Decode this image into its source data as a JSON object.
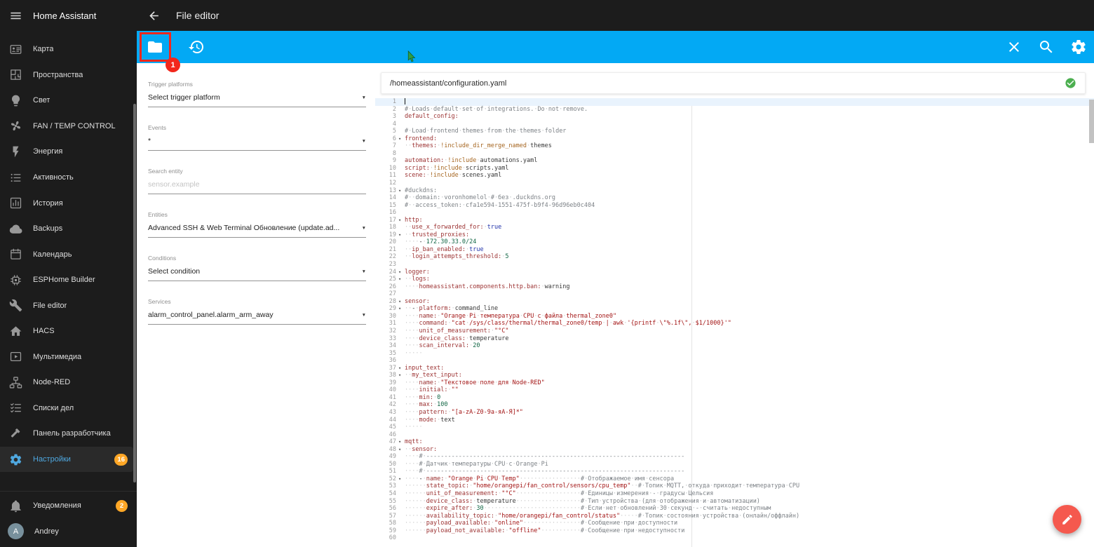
{
  "colors": {
    "sidebar_bg": "#1c1c1c",
    "toolbar_blue": "#03a9f4",
    "active_blue": "#4fa8e0",
    "badge_amber": "#ffa726",
    "annotation_red": "#f2271c",
    "fab_red": "#f5594e",
    "success_green": "#4caf50",
    "avatar_bg": "#78909c"
  },
  "sidebar": {
    "title": "Home Assistant",
    "items": [
      {
        "id": "map",
        "label": "Карта",
        "icon": "card-account-icon"
      },
      {
        "id": "spaces",
        "label": "Пространства",
        "icon": "floor-plan-icon"
      },
      {
        "id": "light",
        "label": "Свет",
        "icon": "lightbulb-icon"
      },
      {
        "id": "fan-temp-control",
        "label": "FAN / TEMP CONTROL",
        "icon": "fan-icon"
      },
      {
        "id": "energy",
        "label": "Энергия",
        "icon": "flash-icon"
      },
      {
        "id": "activity",
        "label": "Активность",
        "icon": "list-icon"
      },
      {
        "id": "history",
        "label": "История",
        "icon": "chart-icon"
      },
      {
        "id": "backups",
        "label": "Backups",
        "icon": "cloud-icon"
      },
      {
        "id": "calendar",
        "label": "Календарь",
        "icon": "calendar-icon"
      },
      {
        "id": "esphome-builder",
        "label": "ESPHome Builder",
        "icon": "chip-icon"
      },
      {
        "id": "file-editor",
        "label": "File editor",
        "icon": "wrench-icon"
      },
      {
        "id": "hacs",
        "label": "HACS",
        "icon": "home-icon"
      },
      {
        "id": "media",
        "label": "Мультимедиа",
        "icon": "media-icon"
      },
      {
        "id": "node-red",
        "label": "Node-RED",
        "icon": "sitemap-icon"
      },
      {
        "id": "todo-lists",
        "label": "Списки дел",
        "icon": "todo-icon"
      },
      {
        "id": "developer-tools",
        "label": "Панель разработчика",
        "icon": "hammer-icon"
      },
      {
        "id": "settings",
        "label": "Настройки",
        "icon": "gear-icon",
        "badge": "16",
        "active": true
      }
    ],
    "bottom_items": [
      {
        "id": "notifications",
        "label": "Уведомления",
        "icon": "bell-icon",
        "badge": "2"
      },
      {
        "id": "profile",
        "label": "Andrey",
        "avatar_letter": "A"
      }
    ]
  },
  "header": {
    "title": "File editor"
  },
  "toolbar": {
    "annotation_badge": "1"
  },
  "panel": {
    "fields": [
      {
        "id": "trigger-platform",
        "type": "select",
        "label": "Trigger platforms",
        "value": "Select trigger platform"
      },
      {
        "id": "events",
        "type": "select",
        "label": "Events",
        "value": "*"
      },
      {
        "id": "search-entity",
        "type": "input",
        "label": "Search entity",
        "placeholder": "sensor.example"
      },
      {
        "id": "entities",
        "type": "select",
        "label": "Entities",
        "value": "Advanced SSH & Web Terminal Обновление (update.ad..."
      },
      {
        "id": "conditions",
        "type": "select",
        "label": "Conditions",
        "value": "Select condition"
      },
      {
        "id": "services",
        "type": "select",
        "label": "Services",
        "value": "alarm_control_panel.alarm_arm_away"
      }
    ]
  },
  "editor": {
    "filepath": "/homeassistant/configuration.yaml",
    "active_line": 1,
    "fold_lines": [
      6,
      13,
      17,
      19,
      24,
      25,
      28,
      29,
      37,
      38,
      47,
      48,
      52
    ],
    "lines": [
      "",
      "# Loads default set of integrations. Do not remove.",
      "default_config:",
      "",
      "# Load frontend themes from the themes folder",
      "frontend:",
      "  themes: !include_dir_merge_named themes",
      "",
      "automation: !include automations.yaml",
      "script: !include scripts.yaml",
      "scene: !include scenes.yaml",
      "",
      "#duckdns:",
      "#  domain: voronhomelol # без .duckdns.org",
      "#  access_token: cfa1e594-1551-475f-b9f4-96d96eb0c404",
      "",
      "http:",
      "  use_x_forwarded_for: true",
      "  trusted_proxies:",
      "    - 172.30.33.0/24",
      "  ip_ban_enabled: true",
      "  login_attempts_threshold: 5",
      "",
      "logger:",
      "  logs:",
      "    homeassistant.components.http.ban: warning",
      "",
      "sensor:",
      "  - platform: command_line",
      "    name: \"Orange Pi температура CPU с файла thermal_zone0\"",
      "    command: \"cat /sys/class/thermal/thermal_zone0/temp | awk '{printf \\\"%.1f\\\", $1/1000}'\"",
      "    unit_of_measurement: \"°C\"",
      "    device_class: temperature",
      "    scan_interval: 20",
      "     ",
      "",
      "input_text:",
      "  my_text_input:",
      "    name: \"Текстовое поле для Node-RED\"",
      "    initial: \"\"",
      "    min: 0",
      "    max: 100",
      "    pattern: \"[a-zA-Z0-9a-яА-Я]*\"",
      "    mode: text",
      "     ",
      "",
      "mqtt:",
      "  sensor:",
      "    # ------------------------------------------------------------------------",
      "    # Датчик температуры CPU с Orange Pi",
      "    # ------------------------------------------------------------------------",
      "    - name: \"Orange Pi CPU Temp\"                 # Отображаемое имя сенсора",
      "      state_topic: \"home/orangepi/fan_control/sensors/cpu_temp\"  # Топик MQTT, откуда приходит температура CPU",
      "      unit_of_measurement: \"°C\"                  # Единицы измерения - градусы Цельсия",
      "      device_class: temperature                  # Тип устройства (для отображения и автоматизации)",
      "      expire_after: 30                           # Если нет обновлений 30 секунд - считать недоступным",
      "      availability_topic: \"home/orangepi/fan_control/status\"     # Топик состояния устройства (онлайн/оффлайн)",
      "      payload_available: \"online\"                # Сообщение при доступности",
      "      payload_not_available: \"offline\"           # Сообщение при недоступности",
      ""
    ]
  }
}
